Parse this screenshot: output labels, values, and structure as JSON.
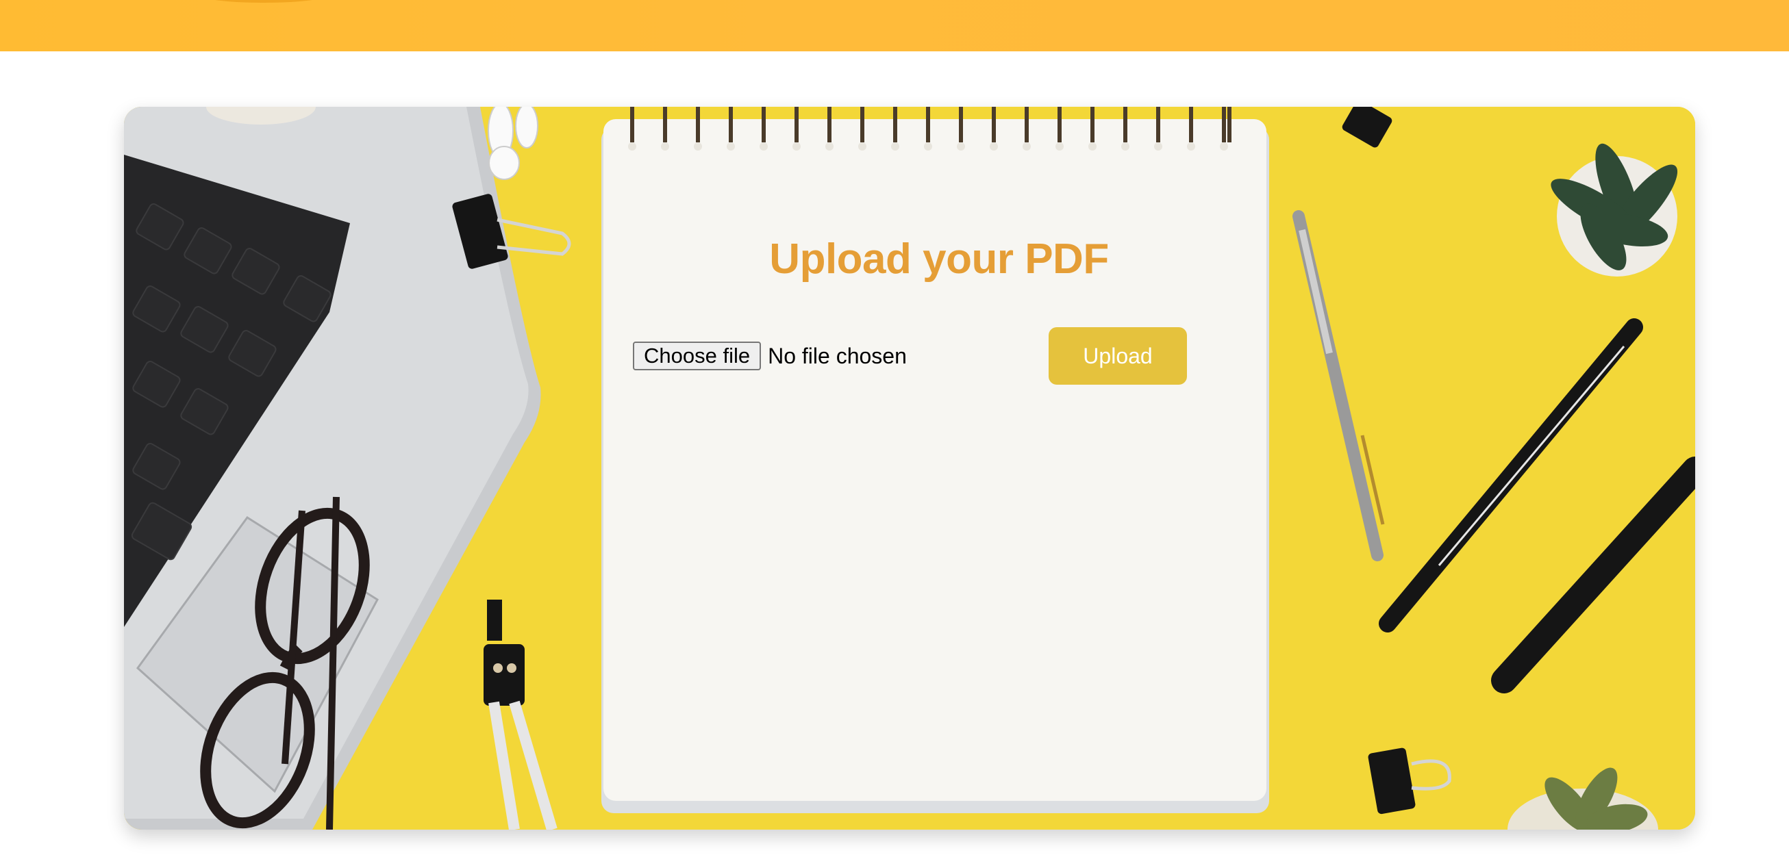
{
  "form": {
    "title": "Upload your PDF",
    "choose_file_label": "Choose file",
    "file_status": "No file chosen",
    "upload_label": "Upload"
  },
  "colors": {
    "banner": "#ffbb33",
    "card_background": "#f2d637",
    "title": "#e59e36",
    "upload_button": "#e5c23d",
    "upload_button_text": "#ffffff"
  }
}
